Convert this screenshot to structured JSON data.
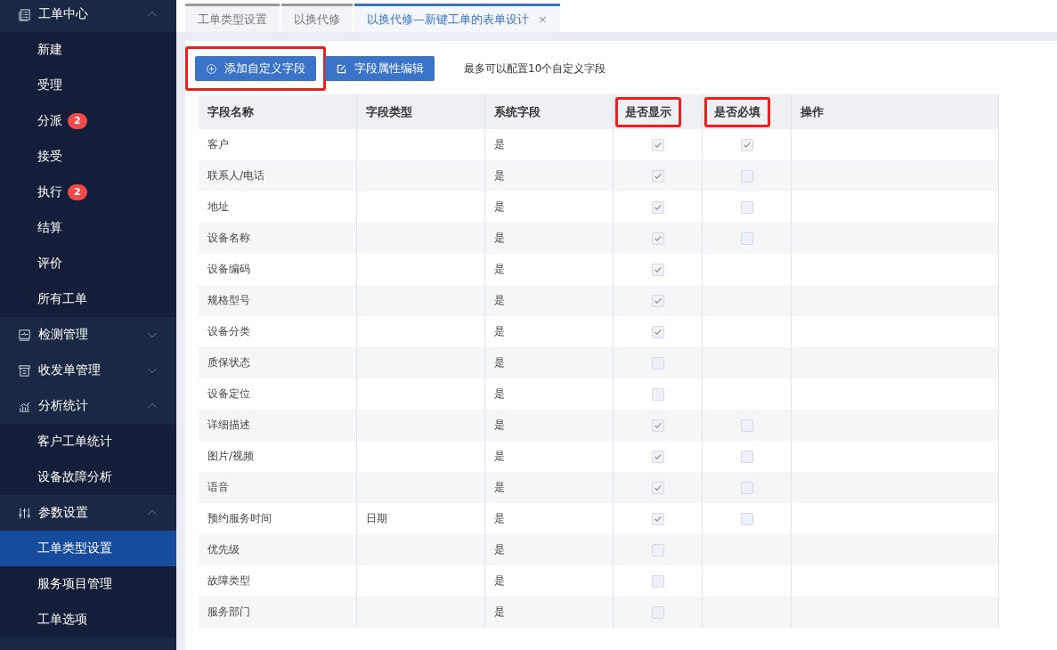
{
  "sidebar": {
    "groups": [
      {
        "label": "工单中心",
        "expanded": true,
        "items": [
          {
            "label": "新建",
            "selected": false
          },
          {
            "label": "受理",
            "selected": false
          },
          {
            "label": "分派",
            "badge": "2",
            "selected": false
          },
          {
            "label": "接受",
            "selected": false
          },
          {
            "label": "执行",
            "badge": "2",
            "selected": false
          },
          {
            "label": "结算",
            "selected": false
          },
          {
            "label": "评价",
            "selected": false
          },
          {
            "label": "所有工单",
            "selected": false
          }
        ]
      },
      {
        "label": "检测管理",
        "expanded": false
      },
      {
        "label": "收发单管理",
        "expanded": false
      },
      {
        "label": "分析统计",
        "expanded": true,
        "items": [
          {
            "label": "客户工单统计",
            "selected": false
          },
          {
            "label": "设备故障分析",
            "selected": false
          }
        ]
      },
      {
        "label": "参数设置",
        "expanded": true,
        "items": [
          {
            "label": "工单类型设置",
            "selected": true
          },
          {
            "label": "服务项目管理",
            "selected": false
          },
          {
            "label": "工单选项",
            "selected": false
          }
        ]
      }
    ]
  },
  "tabs": [
    {
      "label": "工单类型设置",
      "selected": false
    },
    {
      "label": "以换代修",
      "selected": false
    },
    {
      "label": "以换代修—新键工单的表单设计",
      "selected": true,
      "close": "×"
    }
  ],
  "toolbar": {
    "buttons": [
      {
        "label": "添加自定义字段",
        "highlighted": true
      },
      {
        "label": "字段属性编辑",
        "highlighted": false
      }
    ],
    "note": "最多可以配置10个自定义字段"
  },
  "table": {
    "columns": [
      {
        "label": "字段名称",
        "highlighted": false
      },
      {
        "label": "字段类型",
        "highlighted": false
      },
      {
        "label": "系统字段",
        "highlighted": false
      },
      {
        "label": "是否显示",
        "highlighted": true
      },
      {
        "label": "是否必填",
        "highlighted": true
      },
      {
        "label": "操作",
        "highlighted": false
      }
    ],
    "rows": [
      {
        "name": "客户",
        "system": "是",
        "shown": true,
        "kind": "with_required",
        "required": true
      },
      {
        "name": "联系人/电话",
        "system": "是",
        "shown": true,
        "kind": "with_required",
        "required": false
      },
      {
        "name": "地址",
        "system": "是",
        "shown": true,
        "kind": "with_required",
        "required": false
      },
      {
        "name": "设备名称",
        "system": "是",
        "shown": true,
        "kind": "with_required",
        "required": false
      },
      {
        "name": "设备编码",
        "system": "是",
        "shown": true,
        "kind": "display_only"
      },
      {
        "name": "规格型号",
        "system": "是",
        "shown": true,
        "kind": "display_only"
      },
      {
        "name": "设备分类",
        "system": "是",
        "shown": true,
        "kind": "display_only"
      },
      {
        "name": "质保状态",
        "system": "是",
        "shown": false,
        "kind": "display_only"
      },
      {
        "name": "设备定位",
        "system": "是",
        "shown": false,
        "kind": "display_only"
      },
      {
        "name": "详细描述",
        "system": "是",
        "shown": true,
        "kind": "with_required",
        "required": false
      },
      {
        "name": "图片/视频",
        "system": "是",
        "shown": true,
        "kind": "with_required",
        "required": false
      },
      {
        "name": "语音",
        "system": "是",
        "shown": true,
        "kind": "with_required",
        "required": false
      },
      {
        "name": "预约服务时间",
        "type": "日期",
        "system": "是",
        "shown": true,
        "kind": "with_required",
        "required": false
      },
      {
        "name": "优先级",
        "system": "是",
        "shown": false,
        "kind": "display_only"
      },
      {
        "name": "故障类型",
        "system": "是",
        "shown": false,
        "kind": "display_only"
      },
      {
        "name": "服务部门",
        "system": "是",
        "shown": false,
        "kind": "display_only"
      }
    ]
  }
}
